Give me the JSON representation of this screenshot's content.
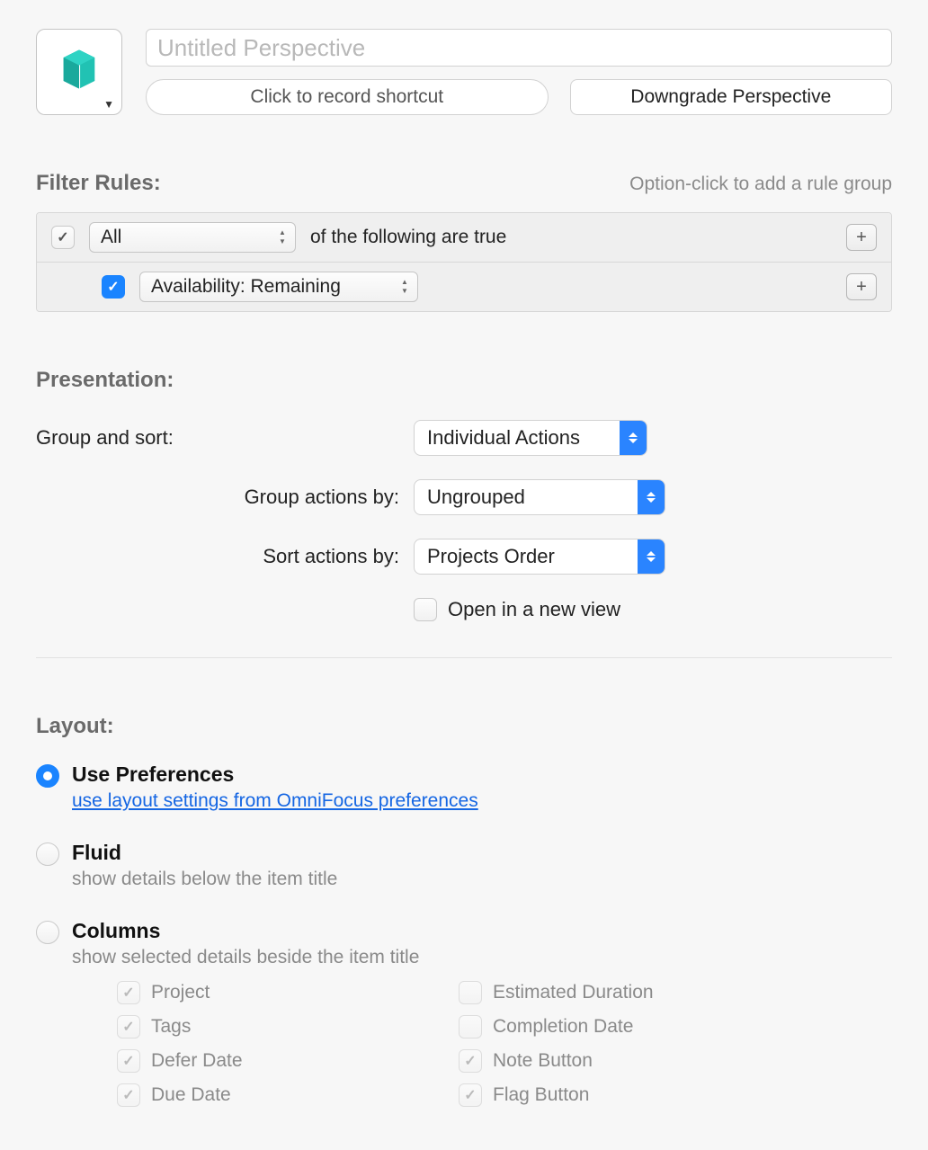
{
  "header": {
    "name_placeholder": "Untitled Perspective",
    "shortcut_button": "Click to record shortcut",
    "downgrade_button": "Downgrade Perspective"
  },
  "filter": {
    "title": "Filter Rules:",
    "hint": "Option-click to add a rule group",
    "root_mode": "All",
    "root_suffix": "of the following are true",
    "rule_1": "Availability: Remaining"
  },
  "presentation": {
    "title": "Presentation:",
    "group_and_sort_label": "Group and sort:",
    "group_and_sort_value": "Individual Actions",
    "group_by_label": "Group actions by:",
    "group_by_value": "Ungrouped",
    "sort_by_label": "Sort actions by:",
    "sort_by_value": "Projects Order",
    "open_new_view": "Open in a new view"
  },
  "layout": {
    "title": "Layout:",
    "use_preferences_label": "Use Preferences",
    "use_preferences_link": "use layout settings from OmniFocus preferences",
    "fluid_label": "Fluid",
    "fluid_sub": "show details below the item title",
    "columns_label": "Columns",
    "columns_sub": "show selected details beside the item title",
    "cols": {
      "project": "Project",
      "tags": "Tags",
      "defer": "Defer Date",
      "due": "Due Date",
      "estimated": "Estimated Duration",
      "completion": "Completion Date",
      "note": "Note Button",
      "flag": "Flag Button"
    }
  }
}
